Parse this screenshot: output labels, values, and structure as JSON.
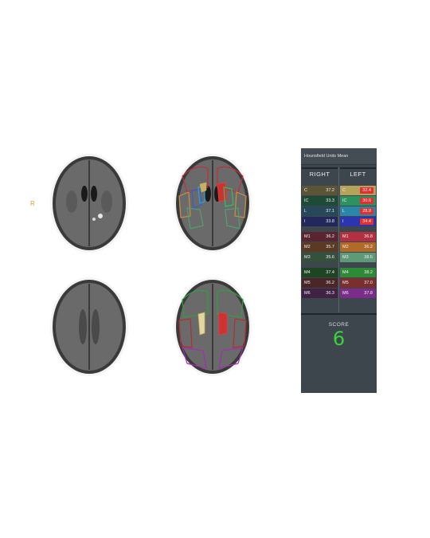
{
  "side_marker": "R",
  "panel": {
    "title": "Hounsfield Units Mean",
    "right_title": "RIGHT",
    "left_title": "LEFT",
    "score_label": "SCORE",
    "score_value": "6"
  },
  "right_rows": [
    {
      "label": "C",
      "value": "37.2",
      "bg": "#5b5436"
    },
    {
      "label": "IC",
      "value": "33.3",
      "bg": "#1e4a38"
    },
    {
      "label": "L",
      "value": "37.1",
      "bg": "#27485a"
    },
    {
      "label": "I",
      "value": "33.8",
      "bg": "#22295a"
    },
    {
      "label": "M1",
      "value": "36.2",
      "bg": "#5a2530"
    },
    {
      "label": "M2",
      "value": "35.7",
      "bg": "#5a3a22"
    },
    {
      "label": "M3",
      "value": "35.6",
      "bg": "#36503e"
    },
    {
      "label": "M4",
      "value": "37.4",
      "bg": "#1e4424"
    },
    {
      "label": "M5",
      "value": "36.2",
      "bg": "#4a2626"
    },
    {
      "label": "M6",
      "value": "36.3",
      "bg": "#402244"
    }
  ],
  "left_rows": [
    {
      "label": "C",
      "value": "32.4",
      "bg": "#b5a35a",
      "flag": true
    },
    {
      "label": "IC",
      "value": "30.6",
      "bg": "#2e9160",
      "flag": true
    },
    {
      "label": "L",
      "value": "28.9",
      "bg": "#2a87aa",
      "flag": true
    },
    {
      "label": "I",
      "value": "34.4",
      "bg": "#2b35b0",
      "flag": true
    },
    {
      "label": "M1",
      "value": "36.8",
      "bg": "#b23040",
      "flag": false
    },
    {
      "label": "M2",
      "value": "36.2",
      "bg": "#b06a2a",
      "flag": false
    },
    {
      "label": "M3",
      "value": "38.5",
      "bg": "#5e9a78",
      "flag": false
    },
    {
      "label": "M4",
      "value": "38.2",
      "bg": "#2e8a36",
      "flag": false
    },
    {
      "label": "M5",
      "value": "37.0",
      "bg": "#7a2e2e",
      "flag": false
    },
    {
      "label": "M6",
      "value": "37.8",
      "bg": "#7a2e8a",
      "flag": false
    }
  ],
  "colors": {
    "flag_box": "#e03030",
    "score": "#3bd23b",
    "panel_bg": "#3e464d"
  }
}
